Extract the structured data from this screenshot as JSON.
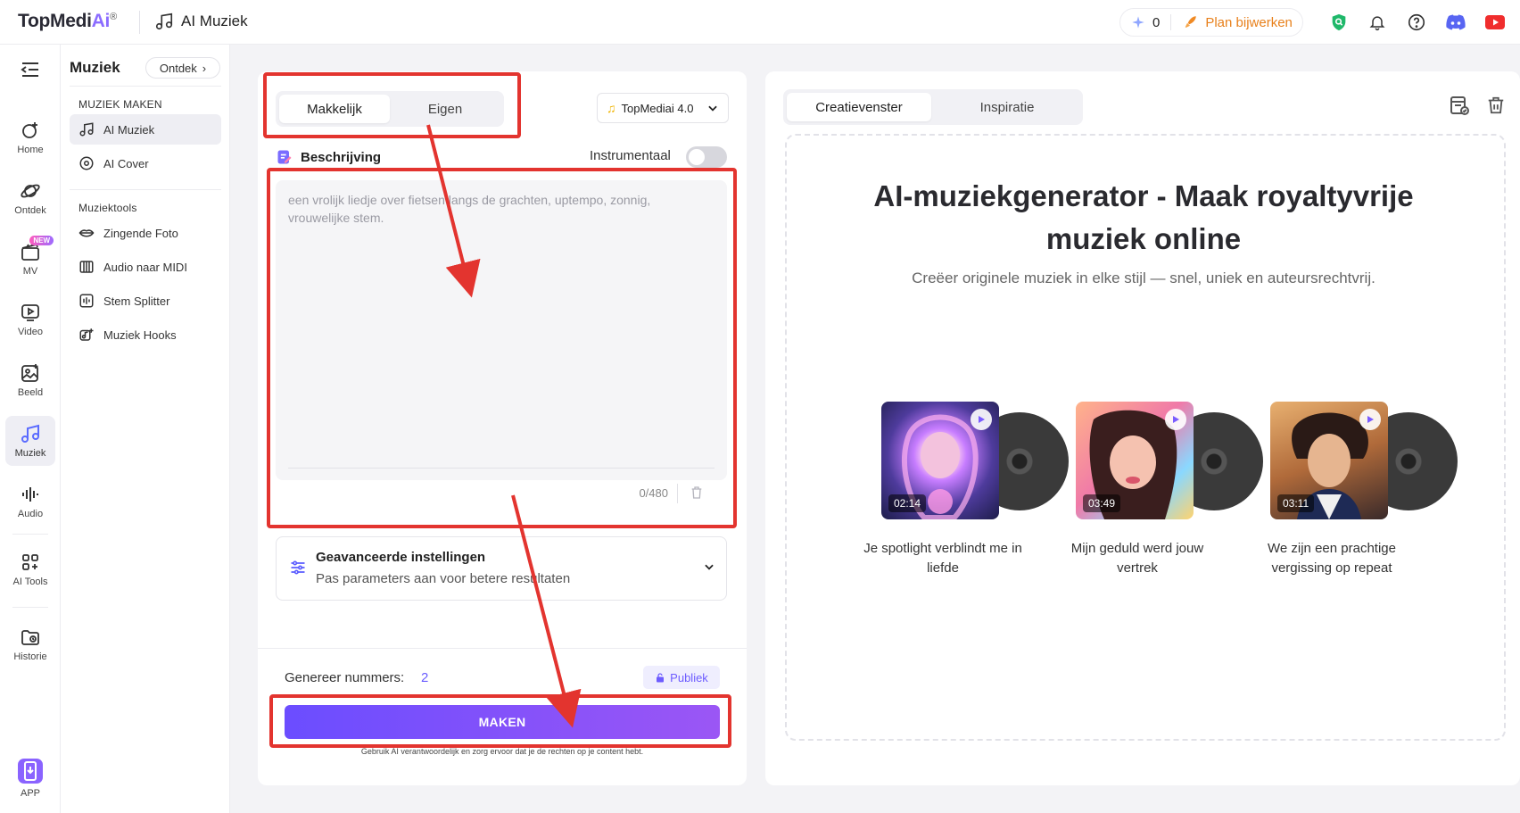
{
  "header": {
    "logo_text": "TopMedi",
    "logo_ai": "Ai",
    "logo_reg": "®",
    "page_title": "AI Muziek",
    "credits": "0",
    "plan_label": "Plan bijwerken"
  },
  "leftnav": {
    "items": [
      {
        "label": "Home"
      },
      {
        "label": "Ontdek"
      },
      {
        "label": "MV",
        "badge": "NEW"
      },
      {
        "label": "Video"
      },
      {
        "label": "Beeld"
      },
      {
        "label": "Muziek"
      },
      {
        "label": "Audio"
      },
      {
        "label": "AI Tools"
      },
      {
        "label": "Historie"
      },
      {
        "label": "APP"
      }
    ]
  },
  "subnav": {
    "title": "Muziek",
    "ontdek": "Ontdek",
    "section1": "MUZIEK MAKEN",
    "items1": [
      "AI Muziek",
      "AI Cover"
    ],
    "section2": "Muziektools",
    "items2": [
      "Zingende Foto",
      "Audio naar MIDI",
      "Stem Splitter",
      "Muziek Hooks"
    ]
  },
  "form": {
    "tabs": [
      "Makkelijk",
      "Eigen"
    ],
    "model": "TopMediai 4.0",
    "desc_label": "Beschrijving",
    "instrumental_label": "Instrumentaal",
    "placeholder": "een vrolijk liedje over fietsen langs de grachten, uptempo, zonnig, vrouwelijke stem.",
    "counter": "0/480",
    "advanced_title": "Geavanceerde instellingen",
    "advanced_sub": "Pas parameters aan voor betere resultaten",
    "generate_label": "Genereer nummers:",
    "generate_count": "2",
    "public_label": "Publiek",
    "submit_label": "MAKEN",
    "disclaimer": "Gebruik AI verantwoordelijk en zorg ervoor dat je de rechten op je content hebt."
  },
  "right": {
    "tabs": [
      "Creatievenster",
      "Inspiratie"
    ],
    "hero_title_line1": "AI-muziekgenerator - Maak royaltyvrije",
    "hero_title_line2": "muziek online",
    "hero_sub": "Creëer originele muziek in elke stijl — snel, uniek en auteursrechtvrij.",
    "songs": [
      {
        "duration": "02:14",
        "title": "Je spotlight verblindt me in liefde"
      },
      {
        "duration": "03:49",
        "title": "Mijn geduld werd jouw vertrek"
      },
      {
        "duration": "03:11",
        "title": "We zijn een prachtige vergissing op repeat"
      }
    ]
  },
  "colors": {
    "accent": "#6b4dff",
    "annotation": "#e3342f",
    "plan": "#e8801b"
  }
}
